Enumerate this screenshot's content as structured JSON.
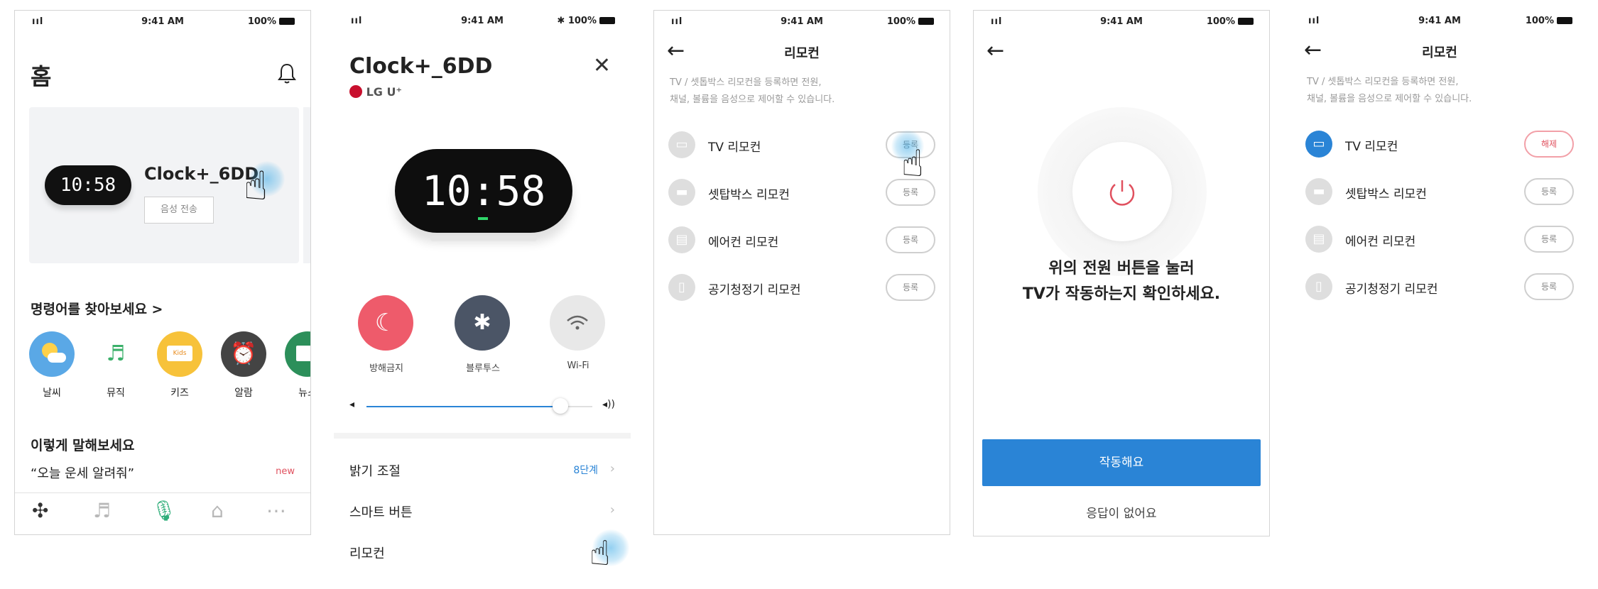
{
  "status": {
    "signal": "ııl",
    "time": "9:41 AM",
    "battery": "100%",
    "bluetooth": "✱"
  },
  "home": {
    "title": "홈",
    "device_name": "Clock+_6DD",
    "clock_time": "10:58",
    "voice_send": "음성 전송",
    "commands_title": "명령어를 찾아보세요 >",
    "commands": [
      {
        "label": "날씨",
        "icon": "weather-icon",
        "color": "#5aa8e6"
      },
      {
        "label": "뮤직",
        "icon": "music-icon",
        "color": "#ffffff"
      },
      {
        "label": "키즈",
        "icon": "kids-icon",
        "color": "#f7c23a"
      },
      {
        "label": "알람",
        "icon": "alarm-icon",
        "color": "#444444"
      },
      {
        "label": "뉴스",
        "icon": "news-icon",
        "color": "#2c8f5a"
      }
    ],
    "say_title": "이렇게 말해보세요",
    "say_example": "“오늘 운세 알려줘”",
    "say_badge": "new"
  },
  "device": {
    "title": "Clock+_6DD",
    "brand": "LG U⁺",
    "clock_time": "10:58",
    "controls": [
      {
        "label": "방해금지",
        "icon": "moon-icon",
        "color": "#ee5b6b"
      },
      {
        "label": "블루투스",
        "icon": "bluetooth-icon",
        "color": "#4b5566"
      },
      {
        "label": "Wi-Fi",
        "icon": "wifi-icon",
        "color": "#e8e8e8"
      }
    ],
    "volume": 0.86,
    "menu": [
      {
        "label": "밝기 조절",
        "value": "8단계"
      },
      {
        "label": "스마트 버튼",
        "value": ""
      },
      {
        "label": "리모컨",
        "value": ""
      }
    ]
  },
  "remote": {
    "title": "리모컨",
    "desc_line1": "TV / 셋톱박스 리모컨을 등록하면 전원,",
    "desc_line2": "채널, 볼륨을 음성으로 제어할 수 있습니다.",
    "items": [
      {
        "label": "TV 리모컨",
        "button": "등록"
      },
      {
        "label": "셋탑박스 리모컨",
        "button": "등록"
      },
      {
        "label": "에어컨 리모컨",
        "button": "등록"
      },
      {
        "label": "공기청정기 리모컨",
        "button": "등록"
      }
    ]
  },
  "test": {
    "line1": "위의 전원 버튼을 눌러",
    "line2": "TV가 작동하는지 확인하세요.",
    "primary": "작동해요",
    "secondary": "응답이 없어요"
  },
  "remote2": {
    "title": "리모컨",
    "desc_line1": "TV / 셋톱박스 리모컨을 등록하면 전원,",
    "desc_line2": "채널, 볼륨을 음성으로 제어할 수 있습니다.",
    "items": [
      {
        "label": "TV 리모컨",
        "button": "해제"
      },
      {
        "label": "셋탑박스 리모컨",
        "button": "등록"
      },
      {
        "label": "에어컨 리모컨",
        "button": "등록"
      },
      {
        "label": "공기청정기 리모컨",
        "button": "등록"
      }
    ]
  }
}
